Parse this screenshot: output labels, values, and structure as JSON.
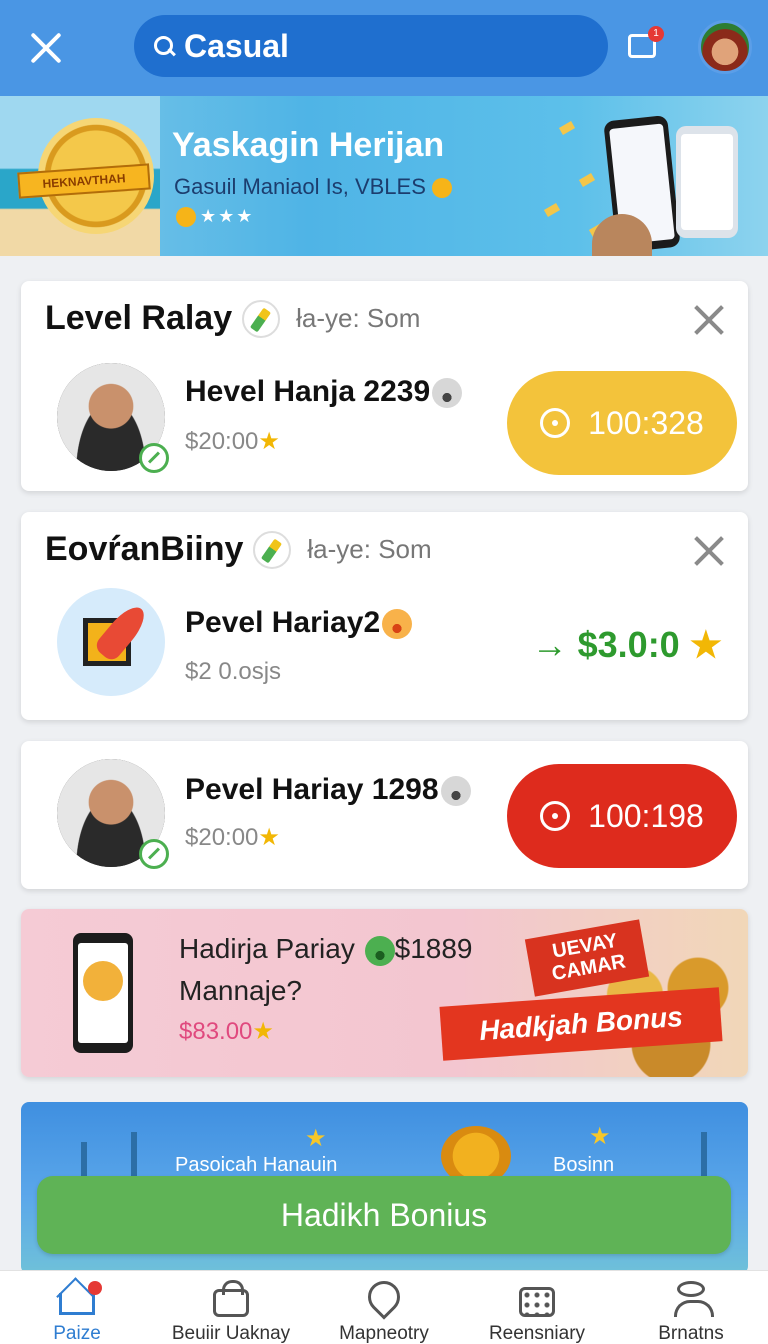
{
  "header": {
    "search_text": "Casual",
    "cart_badge": "1"
  },
  "hero": {
    "badge_text": "HEKNAVTHAH",
    "title": "Yaskagin Herijan",
    "subtitle": "Gasuil Maniaol Is, VBLES",
    "stars": "★★★"
  },
  "cards": [
    {
      "title": "Level Ralay",
      "subtitle": "ła-ye: Som",
      "name": "Hevel Hanja 2239",
      "price": "$20:00",
      "action": "100:328"
    },
    {
      "title": "EovŕanBiiny",
      "subtitle": "ła-ye: Som",
      "name": "Pevel Hariay2",
      "price": "$2 0.osjs",
      "action": "→ $3.0:0"
    },
    {
      "name": "Pevel Hariay 1298",
      "price": "$20:00",
      "action": "100:198"
    }
  ],
  "promo": {
    "line1": "Hadirja Pariay",
    "amount": "$1889",
    "line2": "Mannaje?",
    "price": "$83.00",
    "tag": "UEVAY CAMAR",
    "banner": "Hadkjah Bonus"
  },
  "beach": {
    "left_text": "Pasoicah Hanauin",
    "right_text": "Bosinn",
    "cta": "Hadikh Bonius"
  },
  "nav": {
    "items": [
      {
        "label": "Paize",
        "icon": "home-icon"
      },
      {
        "label": "Beuiir Uaknay",
        "icon": "lock-icon"
      },
      {
        "label": "Mapneotry",
        "icon": "map-pin-icon"
      },
      {
        "label": "Reensniary",
        "icon": "grid-icon"
      },
      {
        "label": "Brnatns",
        "icon": "user-icon"
      }
    ]
  },
  "colors": {
    "primary": "#4a96e4",
    "yellow_pill": "#f3c33b",
    "red_pill": "#de2b1d",
    "green": "#5fb356"
  }
}
